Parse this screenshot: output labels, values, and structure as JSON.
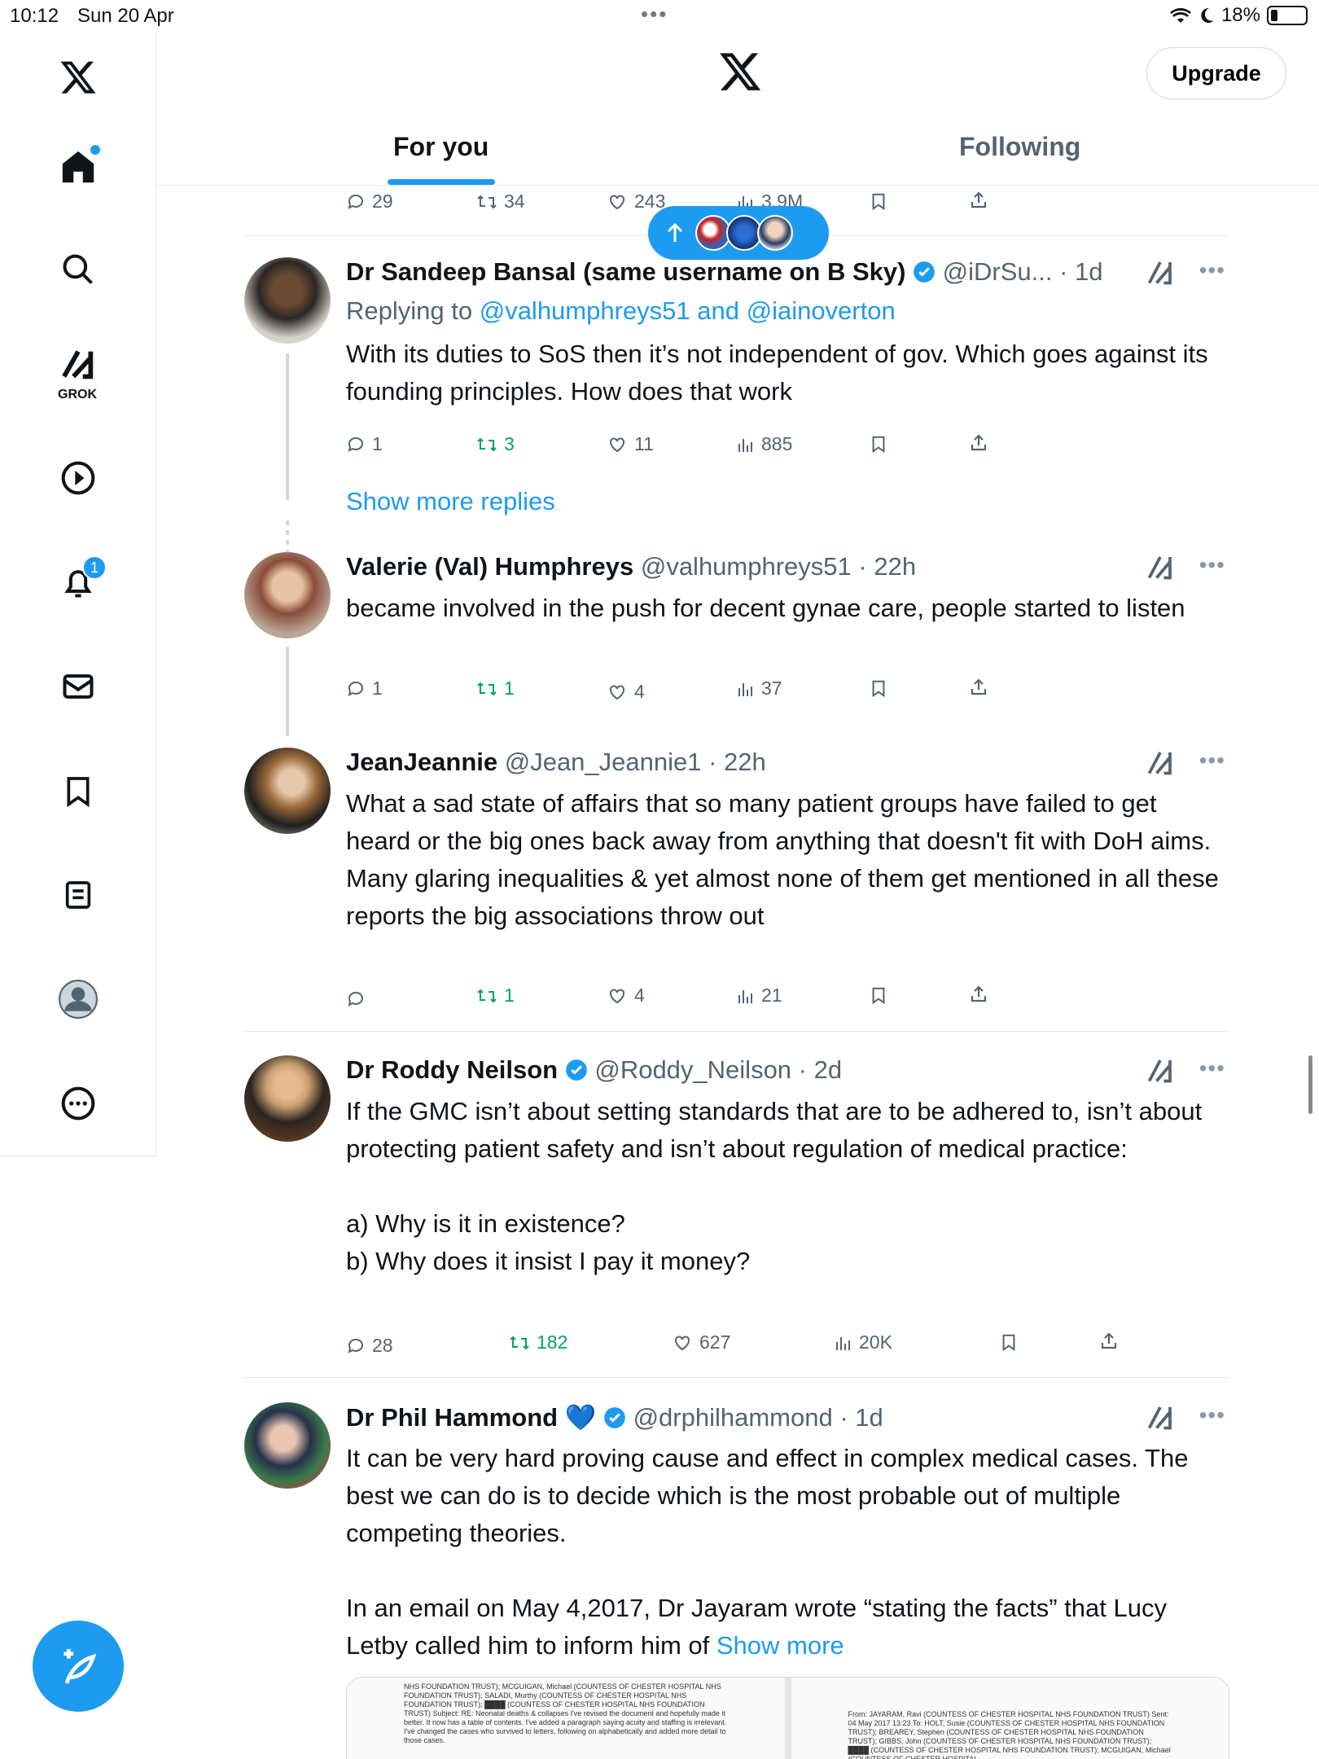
{
  "status_bar": {
    "time": "10:12",
    "date": "Sun 20 Apr",
    "battery": "18%"
  },
  "sidebar": {
    "grok_label": "GROK",
    "notification_count": "1"
  },
  "header": {
    "upgrade_label": "Upgrade",
    "tabs": [
      {
        "label": "For you",
        "active": true
      },
      {
        "label": "Following",
        "active": false
      }
    ]
  },
  "top_partial_actions": {
    "replies": "29",
    "reposts": "34",
    "likes": "243",
    "views": "3.9M"
  },
  "tweets": [
    {
      "name": "Dr Sandeep Bansal (same username on B Sky)",
      "verified": true,
      "handle": "@iDrSu...",
      "time": "· 1d",
      "replying_prefix": "Replying to ",
      "replying_to": "@valhumphreys51 and @iainoverton",
      "text": "With its duties to SoS then it’s not independent of gov. Which goes against its founding principles. How does that work",
      "replies": "1",
      "reposts": "3",
      "likes": "11",
      "views": "885"
    },
    {
      "name": "Valerie (Val) Humphreys",
      "handle": "@valhumphreys51",
      "time": "· 22h",
      "text": "became involved in the push for decent gynae care, people started to listen",
      "replies": "1",
      "reposts": "1",
      "likes": "4",
      "views": "37"
    },
    {
      "name": "JeanJeannie",
      "handle": "@Jean_Jeannie1",
      "time": "· 22h",
      "text": "What a sad state of affairs that so many patient groups have failed to get heard or the big ones back away from anything that doesn't fit with DoH aims.\nMany glaring inequalities & yet almost none of them get mentioned in all these reports the big associations throw out",
      "replies": "",
      "reposts": "1",
      "likes": "4",
      "views": "21"
    },
    {
      "name": "Dr Roddy Neilson",
      "verified": true,
      "handle": "@Roddy_Neilson",
      "time": "· 2d",
      "text": "If the GMC isn’t about setting standards that are to be adhered to, isn’t about protecting patient safety and isn’t about regulation of medical practice:\n\na) Why is it in existence?\nb) Why does it insist I pay it money?",
      "replies": "28",
      "reposts": "182",
      "likes": "627",
      "views": "20K"
    },
    {
      "name": "Dr Phil Hammond",
      "emoji": "💙",
      "verified": true,
      "handle": "@drphilhammond",
      "time": "· 1d",
      "text": "It can be very hard proving cause and effect in complex medical cases. The best we can do is to decide which is the most probable out of multiple competing theories.\n\nIn an email on May 4,2017,  Dr Jayaram wrote “stating the  facts” that Lucy Letby called him to inform him of ",
      "show_more": "Show more"
    }
  ],
  "show_more_replies": "Show more replies",
  "media_docs": [
    "NHS FOUNDATION TRUST); MCGUIGAN, Michael (COUNTESS OF CHESTER HOSPITAL NHS FOUNDATION TRUST); SALADI, Murthy (COUNTESS OF CHESTER HOSPITAL NHS FOUNDATION TRUST); ████ (COUNTESS OF CHESTER HOSPITAL NHS FOUNDATION TRUST) Subject: RE: Neonatal deaths & collapses I've revised the document and hopefully made it better. It now has a table of contents. I've added a paragraph saying acuity and staffing is irrelevant. I've changed the cases who survived to letters, following on alphabetically and added more detail to those cases.",
    "From: JAYARAM, Ravi (COUNTESS OF CHESTER HOSPITAL NHS FOUNDATION TRUST) Sent: 04 May 2017 13:23 To: HOLT, Susie (COUNTESS OF CHESTER HOSPITAL NHS FOUNDATION TRUST); BREAREY, Stephen (COUNTESS OF CHESTER HOSPITAL NHS FOUNDATION TRUST); GIBBS, John (COUNTESS OF CHESTER HOSPITAL NHS FOUNDATION TRUST); ████ (COUNTESS OF CHESTER HOSPITAL NHS FOUNDATION TRUST); MCGUIGAN, Michael (COUNTESS OF CHESTER HOSPITAL"
  ],
  "colors": {
    "accent": "#1d9bf0",
    "repost_green": "#00a36c",
    "secondary_text": "#536471"
  }
}
